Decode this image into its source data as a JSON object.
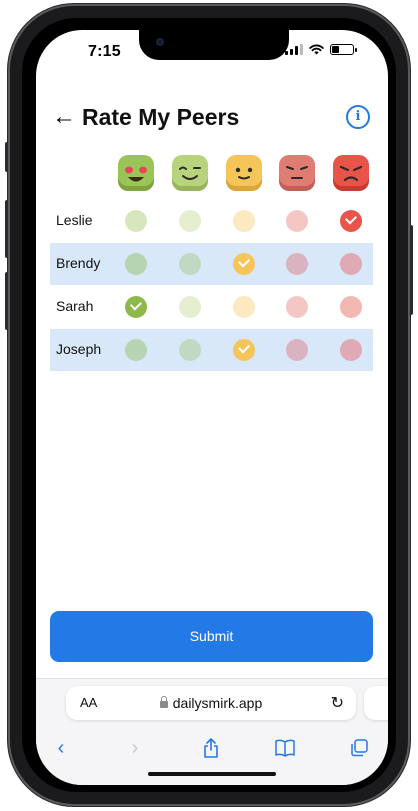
{
  "status_bar": {
    "time": "7:15"
  },
  "header": {
    "title": "Rate My Peers",
    "back_icon": "arrow-left-icon",
    "info_icon": "info-icon"
  },
  "colors": {
    "accent": "#2379e6",
    "row_highlight": "#d8e8f8",
    "scale": [
      "#9bc458",
      "#b7d37b",
      "#f5c55a",
      "#e07d73",
      "#e8544a"
    ],
    "scale_light": [
      "#d7e6bd",
      "#e5efcf",
      "#fde9bf",
      "#f3c7c4",
      "#f3b8b1"
    ],
    "scale_dim": [
      "#b7d4b2",
      "#c1d9c3",
      "#f5c55a",
      "#d9b3c0",
      "#e0a9b6"
    ]
  },
  "rating_scale": [
    {
      "icon": "love-face-icon"
    },
    {
      "icon": "wink-face-icon"
    },
    {
      "icon": "neutral-face-icon"
    },
    {
      "icon": "annoyed-face-icon"
    },
    {
      "icon": "angry-face-icon"
    }
  ],
  "peers": [
    {
      "name": "Leslie",
      "selected": 4,
      "highlight": false
    },
    {
      "name": "Brendy",
      "selected": 2,
      "highlight": true
    },
    {
      "name": "Sarah",
      "selected": 0,
      "highlight": false
    },
    {
      "name": "Joseph",
      "selected": 2,
      "highlight": true
    }
  ],
  "submit_label": "Submit",
  "browser": {
    "text_size_label": "AA",
    "url": "dailysmirk.app"
  }
}
